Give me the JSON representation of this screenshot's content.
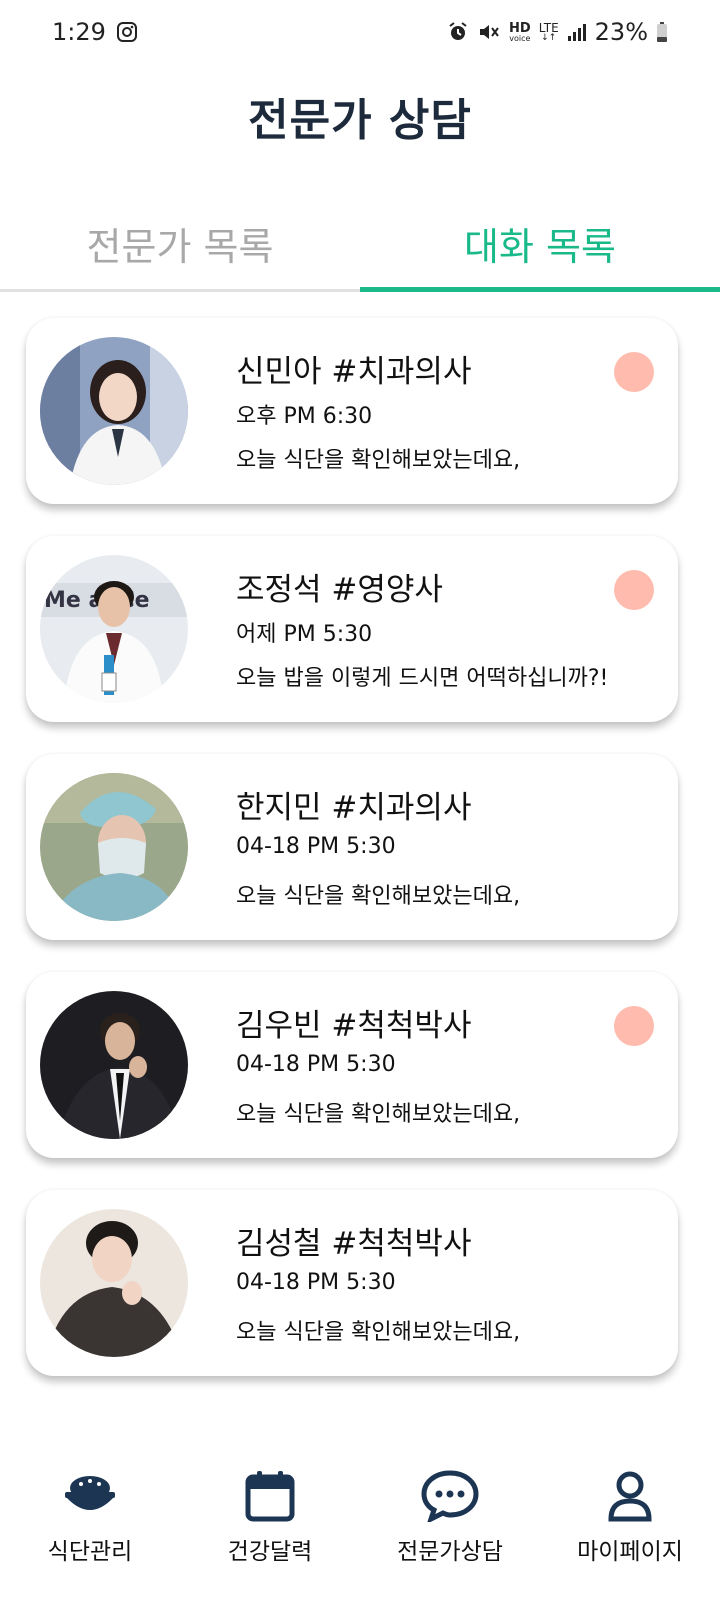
{
  "status_bar": {
    "time": "1:29",
    "battery": "23%",
    "icons": [
      "instagram-icon",
      "alarm-icon",
      "mute-icon",
      "hd-voice-icon",
      "lte-icon",
      "signal-icon",
      "battery-icon"
    ],
    "hd": "HD",
    "voice": "voice",
    "lte": "LTE"
  },
  "header": {
    "title": "전문가 상담"
  },
  "tabs": [
    {
      "label": "전문가 목록",
      "active": false
    },
    {
      "label": "대화 목록",
      "active": true
    }
  ],
  "chats": [
    {
      "name": "신민아 #치과의사",
      "time": "오후 PM 6:30",
      "message": "오늘 식단을 확인해보았는데요,",
      "unread": true
    },
    {
      "name": "조정석 #영양사",
      "time": "어제 PM 5:30",
      "message": "오늘 밥을 이렇게 드시면 어떡하십니까?!",
      "unread": true
    },
    {
      "name": "한지민 #치과의사",
      "time": "04-18 PM 5:30",
      "message": "오늘 식단을 확인해보았는데요,",
      "unread": false
    },
    {
      "name": "김우빈 #척척박사",
      "time": "04-18 PM 5:30",
      "message": "오늘 식단을 확인해보았는데요,",
      "unread": true
    },
    {
      "name": "김성철 #척척박사",
      "time": "04-18 PM 5:30",
      "message": "오늘 식단을 확인해보았는데요,",
      "unread": false
    }
  ],
  "bottom_nav": [
    {
      "label": "식단관리",
      "icon": "rice-bowl-icon"
    },
    {
      "label": "건강달력",
      "icon": "calendar-icon"
    },
    {
      "label": "전문가상담",
      "icon": "chat-bubble-icon"
    },
    {
      "label": "마이페이지",
      "icon": "person-icon"
    }
  ],
  "colors": {
    "accent": "#19b98a",
    "title": "#1c2a3c",
    "unread_dot": "#ffbcae",
    "nav_icon": "#1c3553"
  }
}
